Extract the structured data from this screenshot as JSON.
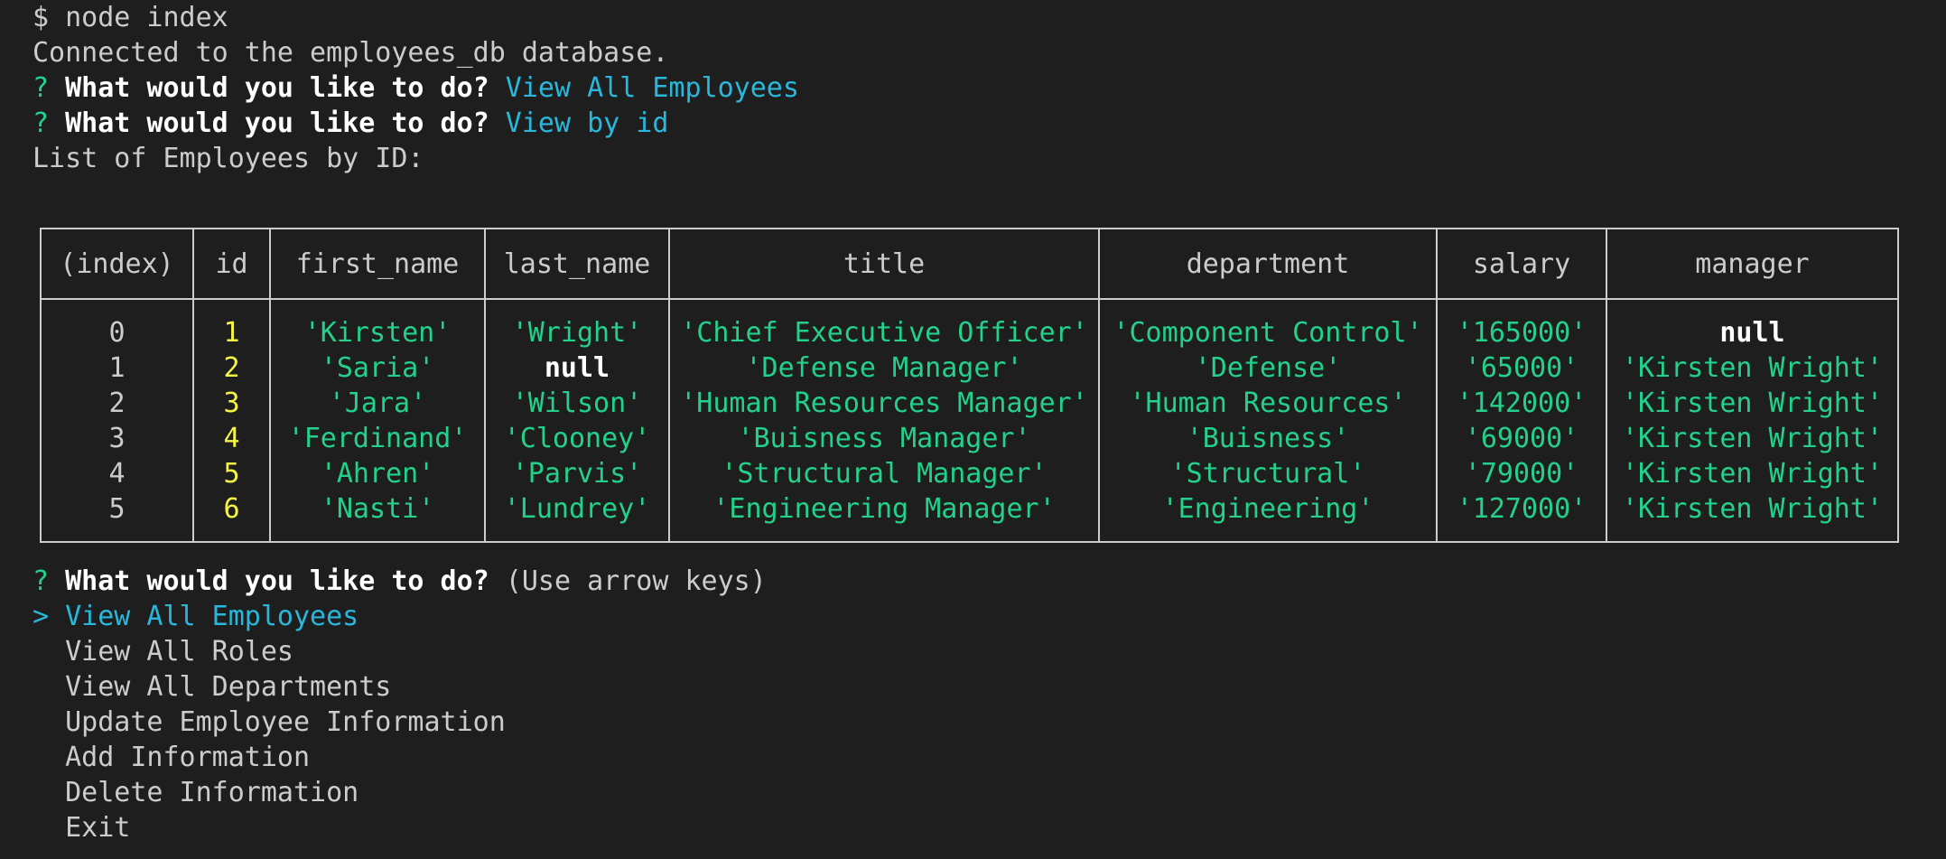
{
  "terminal": {
    "command_line": "$ node index",
    "connected_msg": "Connected to the employees_db database.",
    "prompt_symbol": "?",
    "question": "What would you like to do?",
    "answer1": "View All Employees",
    "answer2": "View by id",
    "list_heading": "List of Employees by ID:"
  },
  "table": {
    "headers": [
      "(index)",
      "id",
      "first_name",
      "last_name",
      "title",
      "department",
      "salary",
      "manager"
    ],
    "rows": [
      {
        "index": "0",
        "id": "1",
        "first_name": "'Kirsten'",
        "last_name": "'Wright'",
        "title": "'Chief Executive Officer'",
        "department": "'Component Control'",
        "salary": "'165000'",
        "manager": "null"
      },
      {
        "index": "1",
        "id": "2",
        "first_name": "'Saria'",
        "last_name": "null",
        "title": "'Defense Manager'",
        "department": "'Defense'",
        "salary": "'65000'",
        "manager": "'Kirsten Wright'"
      },
      {
        "index": "2",
        "id": "3",
        "first_name": "'Jara'",
        "last_name": "'Wilson'",
        "title": "'Human Resources Manager'",
        "department": "'Human Resources'",
        "salary": "'142000'",
        "manager": "'Kirsten Wright'"
      },
      {
        "index": "3",
        "id": "4",
        "first_name": "'Ferdinand'",
        "last_name": "'Clooney'",
        "title": "'Buisness Manager'",
        "department": "'Buisness'",
        "salary": "'69000'",
        "manager": "'Kirsten Wright'"
      },
      {
        "index": "4",
        "id": "5",
        "first_name": "'Ahren'",
        "last_name": "'Parvis'",
        "title": "'Structural Manager'",
        "department": "'Structural'",
        "salary": "'79000'",
        "manager": "'Kirsten Wright'"
      },
      {
        "index": "5",
        "id": "6",
        "first_name": "'Nasti'",
        "last_name": "'Lundrey'",
        "title": "'Engineering Manager'",
        "department": "'Engineering'",
        "salary": "'127000'",
        "manager": "'Kirsten Wright'"
      }
    ]
  },
  "menu": {
    "hint": "(Use arrow keys)",
    "pointer": ">",
    "options": [
      "View All Employees",
      "View All Roles",
      "View All Departments",
      "Update Employee Information",
      "Add Information",
      "Delete Information",
      "Exit"
    ],
    "selected_index": 0
  }
}
